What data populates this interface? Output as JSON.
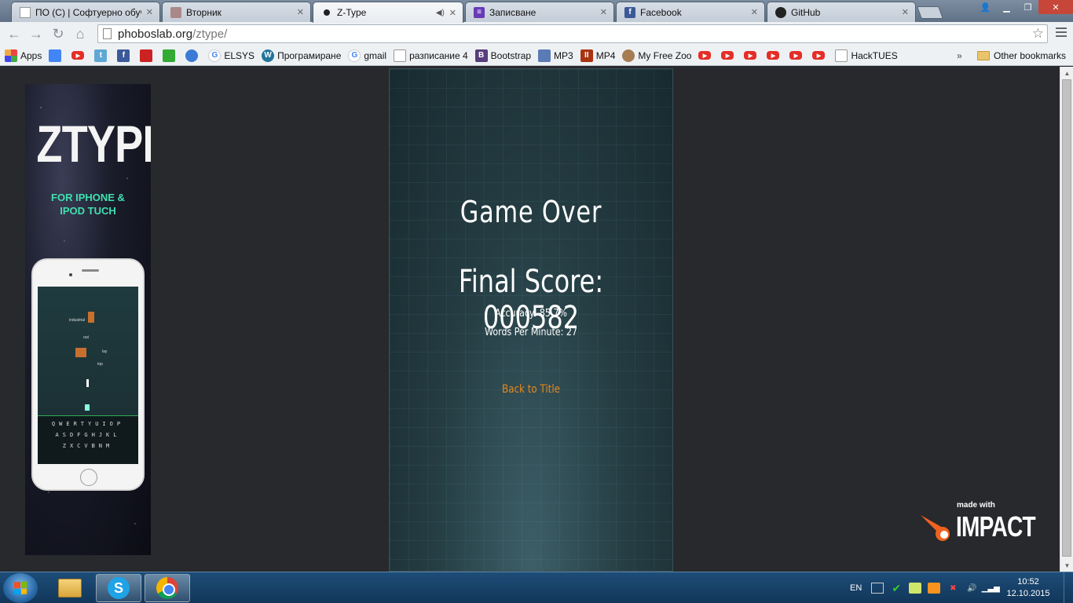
{
  "browser": {
    "tabs": [
      {
        "label": "ПО (С) | Софтуерно обуч",
        "icon": "generic-page-icon",
        "active": false
      },
      {
        "label": "Вторник",
        "icon": "person-icon",
        "active": false
      },
      {
        "label": "Z-Type",
        "icon": "ztype-dot-icon",
        "active": true
      },
      {
        "label": "Записване",
        "icon": "form-list-icon",
        "active": false
      },
      {
        "label": "Facebook",
        "icon": "facebook-icon",
        "active": false
      },
      {
        "label": "GitHub",
        "icon": "github-icon",
        "active": false
      }
    ],
    "url_host": "phoboslab.org",
    "url_path": "/ztype/",
    "bookmarks": [
      {
        "label": "Apps",
        "icon": "apps-grid-icon"
      },
      {
        "label": "",
        "icon": "drive-icon"
      },
      {
        "label": "",
        "icon": "youtube-icon"
      },
      {
        "label": "",
        "icon": "t-icon"
      },
      {
        "label": "",
        "icon": "facebook-icon"
      },
      {
        "label": "",
        "icon": "red-mountain-icon"
      },
      {
        "label": "",
        "icon": "home-icon"
      },
      {
        "label": "",
        "icon": "globe-icon"
      },
      {
        "label": "ELSYS",
        "icon": "google-icon"
      },
      {
        "label": "Програмиране",
        "icon": "wordpress-icon"
      },
      {
        "label": "gmail",
        "icon": "google-icon"
      },
      {
        "label": "разписание 4",
        "icon": "page-icon"
      },
      {
        "label": "Bootstrap",
        "icon": "bootstrap-icon"
      },
      {
        "label": "MP3",
        "icon": "yt-mp3-icon"
      },
      {
        "label": "MP4",
        "icon": "mp4-icon"
      },
      {
        "label": "My Free Zoo",
        "icon": "zoo-icon"
      },
      {
        "label": "",
        "icon": "youtube-icon"
      },
      {
        "label": "",
        "icon": "youtube-icon"
      },
      {
        "label": "",
        "icon": "youtube-icon"
      },
      {
        "label": "",
        "icon": "youtube-icon"
      },
      {
        "label": "",
        "icon": "youtube-icon"
      },
      {
        "label": "",
        "icon": "youtube-icon"
      },
      {
        "label": "HackTUES",
        "icon": "page-icon"
      }
    ],
    "more_bookmarks": "»",
    "other_bookmarks": "Other bookmarks"
  },
  "ad": {
    "title": "ZTYPE",
    "subtitle_line1": "FOR IPHONE &",
    "subtitle_line2": "IPOD TUCH",
    "kb_row1": "QWERTYUIOP",
    "kb_row2": "ASDFGHJKL",
    "kb_row3": "ZXCVBNM",
    "screen_words": [
      "industrial",
      "out",
      "lay",
      "top"
    ]
  },
  "game": {
    "heading": "Game Over",
    "final_score": "Final Score: 000582",
    "accuracy": "Accuracy: 85.7%",
    "wpm": "Words Per Minute: 27",
    "back_link": "Back to Title"
  },
  "impact_logo": {
    "made_with": "made with",
    "word": "IMPACT"
  },
  "taskbar": {
    "language": "EN",
    "time": "10:52",
    "date": "12.10.2015 г."
  },
  "colors": {
    "accent_orange": "#e5881e",
    "game_bg": "#1b3238",
    "ad_teal": "#3fe0b0",
    "page_bg": "#27292d"
  }
}
